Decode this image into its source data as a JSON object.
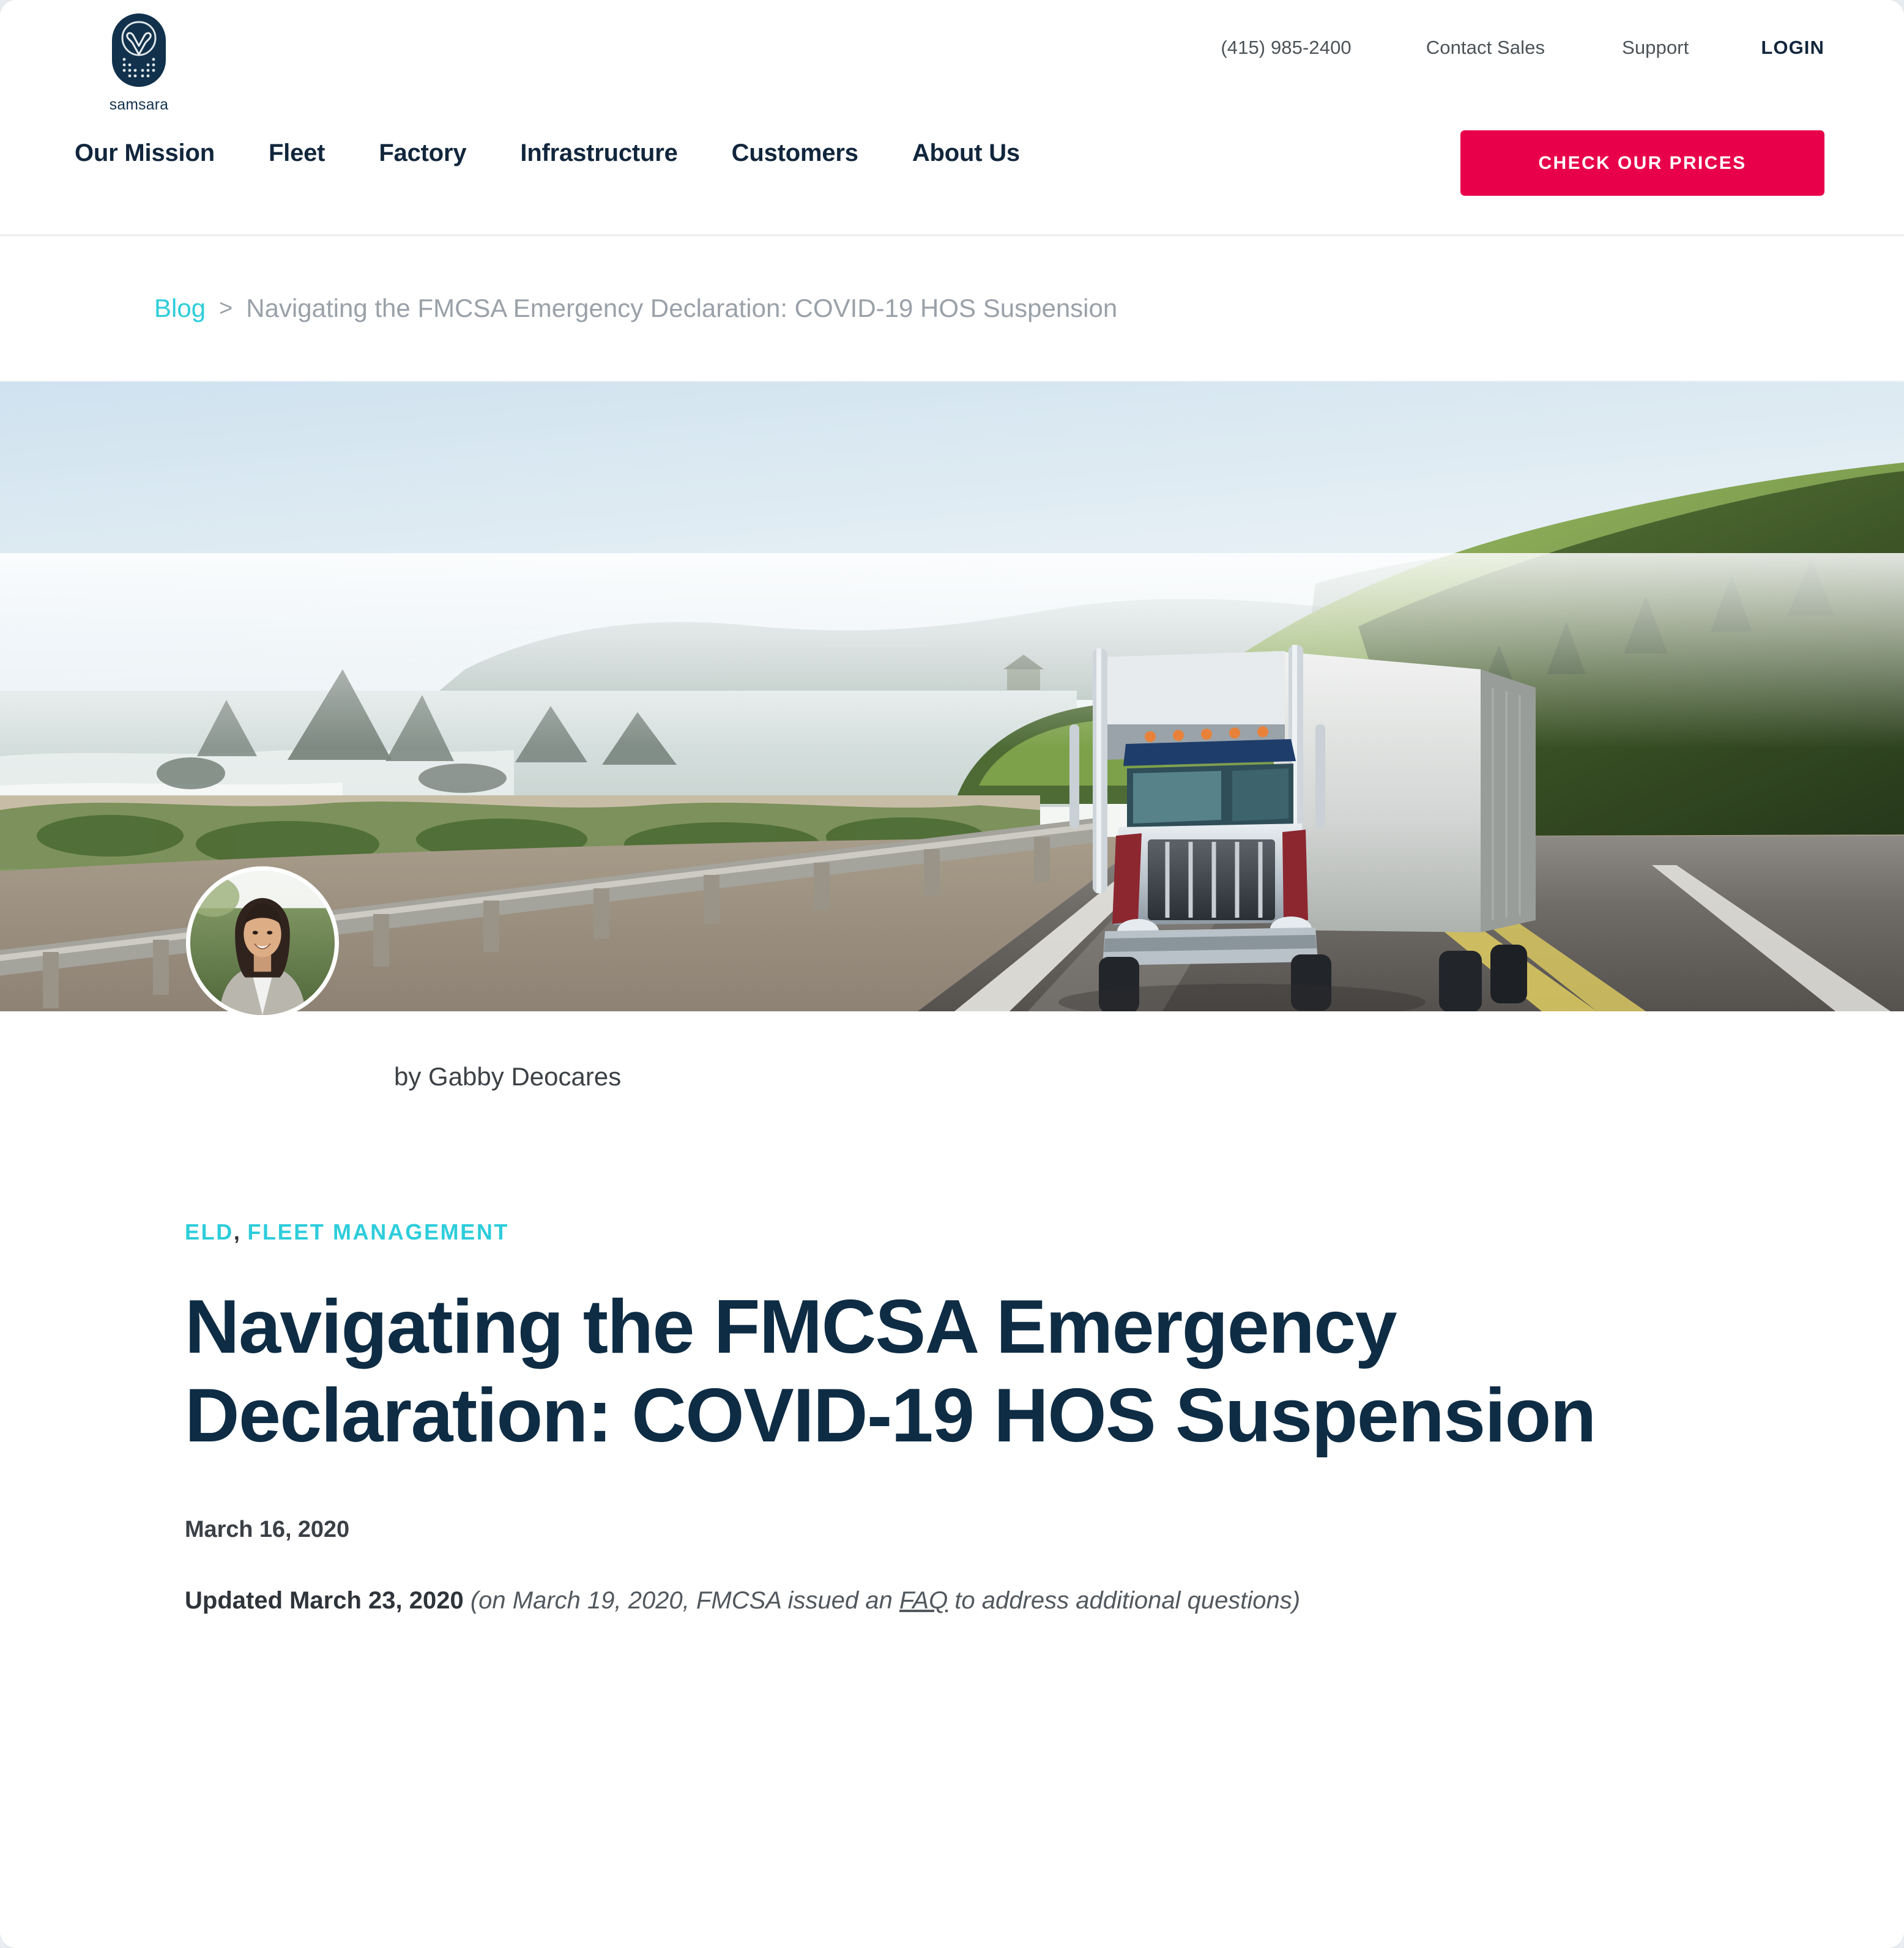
{
  "brand": {
    "name": "samsara",
    "logo_icon": "samsara-owl-logo",
    "navy": "#0e2c44",
    "teal": "#2dcddb",
    "crimson": "#e8004b"
  },
  "header": {
    "topbar": {
      "phone": "(415) 985-2400",
      "contact_sales": "Contact Sales",
      "support": "Support",
      "login": "LOGIN"
    },
    "nav": [
      {
        "label": "Our Mission"
      },
      {
        "label": "Fleet"
      },
      {
        "label": "Factory"
      },
      {
        "label": "Infrastructure"
      },
      {
        "label": "Customers"
      },
      {
        "label": "About Us"
      }
    ],
    "cta_label": "CHECK OUR PRICES"
  },
  "breadcrumb": {
    "home": "Blog",
    "separator": ">",
    "current": "Navigating the FMCSA Emergency Declaration: COVID-19 HOS Suspension"
  },
  "hero": {
    "alt": "Semi truck driving on a coastal highway at sunrise"
  },
  "author": {
    "byline": "by Gabby Deocares",
    "avatar_alt": "Gabby Deocares headshot"
  },
  "article": {
    "categories": [
      {
        "label": "ELD"
      },
      {
        "label": "FLEET MANAGEMENT"
      }
    ],
    "category_separator": ",",
    "title": "Navigating the FMCSA Emergency Declaration: COVID-19 HOS Suspension",
    "date": "March 16, 2020",
    "updated": {
      "bold_prefix": "Updated March 23, 2020",
      "italic_open": " (on March 19, 2020, FMCSA issued an ",
      "link": "FAQ",
      "italic_close": " to address additional questions)"
    }
  }
}
